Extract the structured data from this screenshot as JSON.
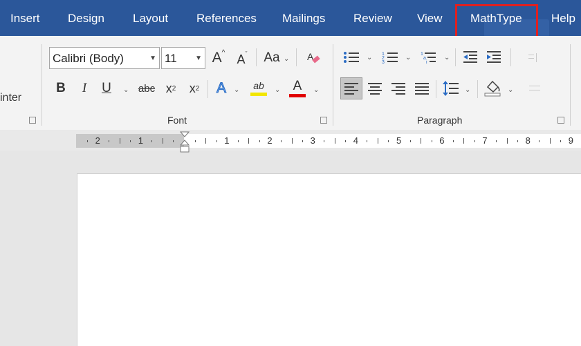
{
  "tabs": [
    {
      "label": "Insert"
    },
    {
      "label": "Design"
    },
    {
      "label": "Layout"
    },
    {
      "label": "References"
    },
    {
      "label": "Mailings"
    },
    {
      "label": "Review"
    },
    {
      "label": "View"
    },
    {
      "label": "MathType"
    },
    {
      "label": "Help"
    }
  ],
  "clipboard": {
    "format_painter_partial": "inter"
  },
  "font": {
    "font_name": "Calibri (Body)",
    "font_size": "11",
    "grow_glyph": "A",
    "shrink_glyph": "A",
    "change_case_glyph": "Aa",
    "bold": "B",
    "italic": "I",
    "underline": "U",
    "strike": "abc",
    "subscript": "x",
    "sub_mark": "2",
    "superscript": "x",
    "sup_mark": "2",
    "text_effects_glyph": "A",
    "highlight_glyph": "ab",
    "font_color_glyph": "A",
    "group_label": "Font",
    "highlight_color": "#f2e600",
    "font_color": "#e00000"
  },
  "paragraph": {
    "group_label": "Paragraph"
  },
  "ruler": {
    "left_numbers": [
      "2",
      "1"
    ],
    "right_numbers": [
      "1",
      "2",
      "3",
      "4",
      "5",
      "6",
      "7",
      "8",
      "9"
    ]
  },
  "colors": {
    "tab_bar": "#2b579a",
    "highlight_box": "#e02020"
  }
}
